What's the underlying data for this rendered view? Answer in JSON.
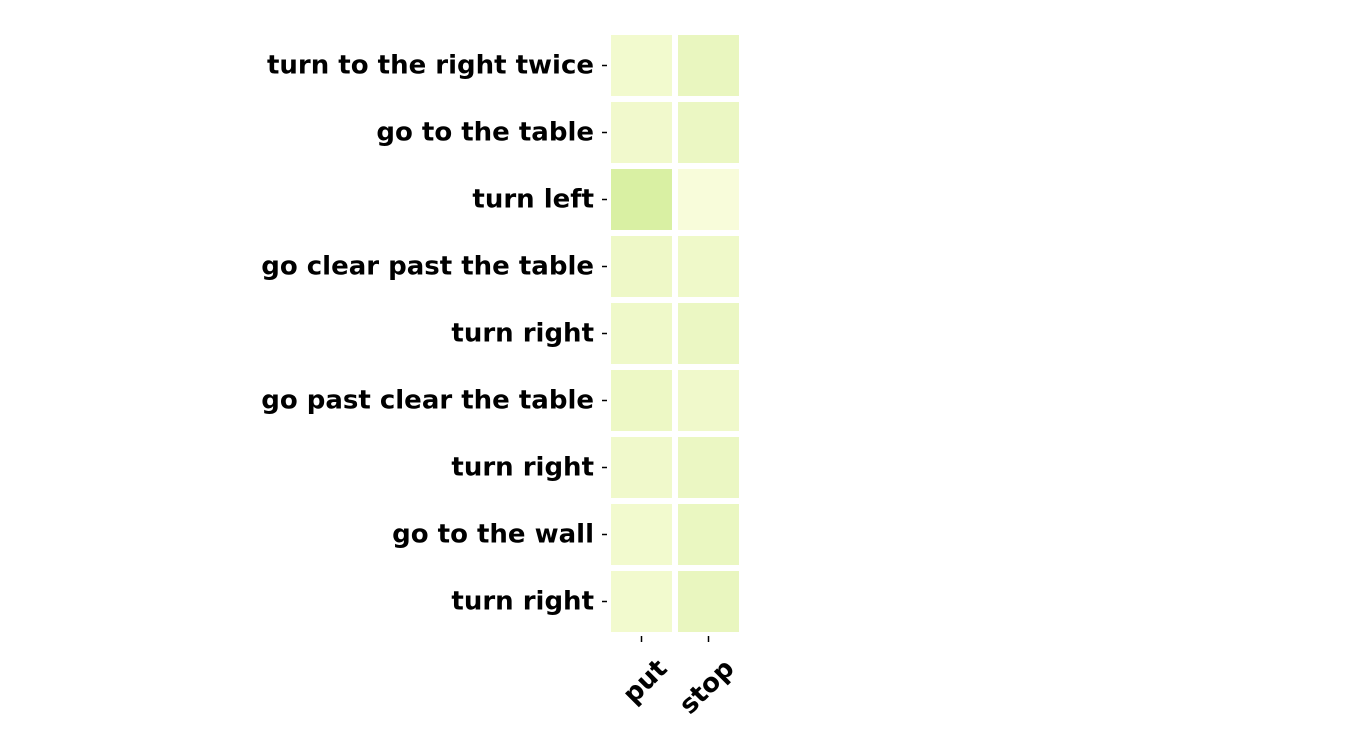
{
  "chart_data": {
    "type": "heatmap",
    "rows": [
      "turn to the right twice",
      "go to the table",
      "turn left",
      "go clear past the table",
      "turn right",
      "go past clear the table",
      "turn right",
      "go to the wall",
      "turn right"
    ],
    "columns": [
      "put",
      "stop"
    ],
    "values": [
      [
        0.12,
        0.2
      ],
      [
        0.13,
        0.18
      ],
      [
        0.35,
        0.06
      ],
      [
        0.16,
        0.15
      ],
      [
        0.15,
        0.18
      ],
      [
        0.17,
        0.14
      ],
      [
        0.14,
        0.18
      ],
      [
        0.12,
        0.19
      ],
      [
        0.12,
        0.2
      ]
    ],
    "colorscale": {
      "low": "#ffffe5",
      "high": "#d9f0a3"
    }
  }
}
